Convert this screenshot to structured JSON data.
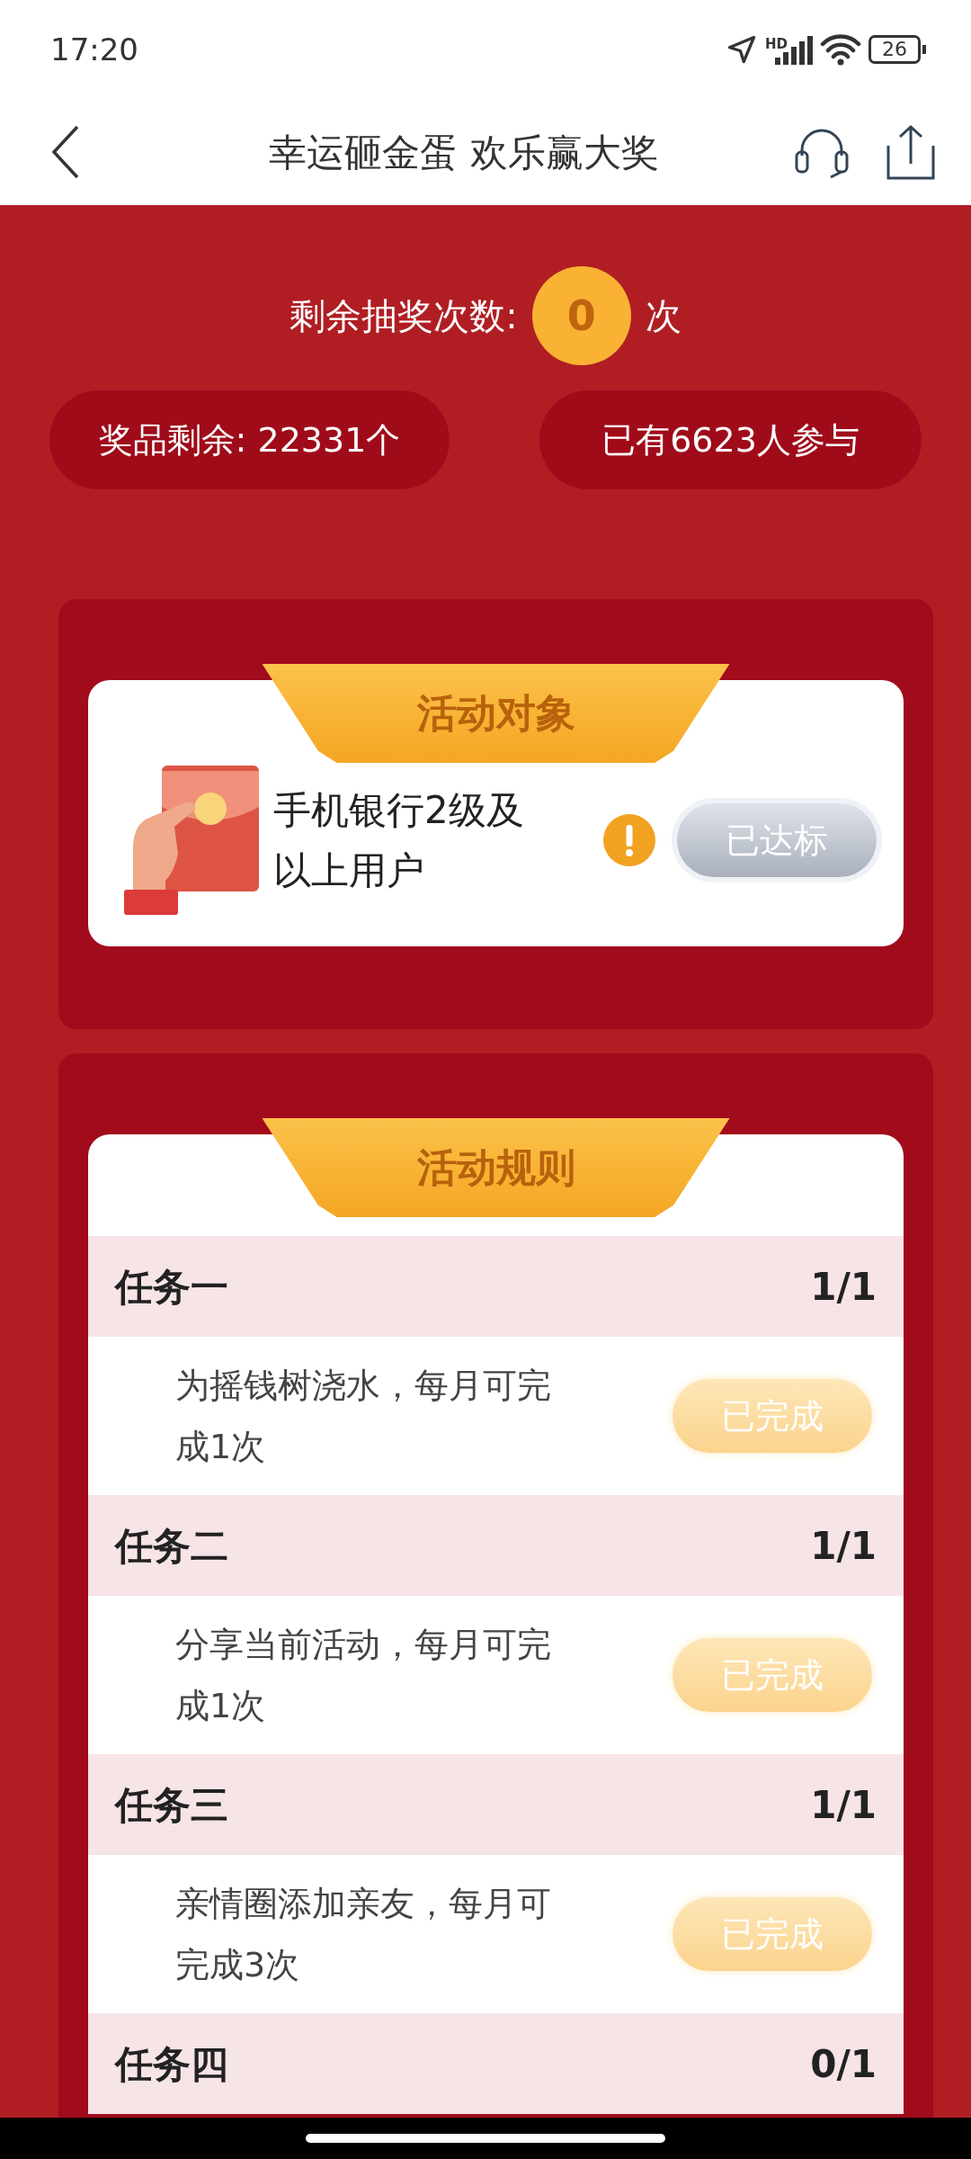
{
  "status_bar": {
    "time": "17:20",
    "network": "HD",
    "battery": "26"
  },
  "nav": {
    "title": "幸运砸金蛋 欢乐赢大奖"
  },
  "draws": {
    "label": "剩余抽奖次数:",
    "count": "0",
    "unit": "次"
  },
  "stats": [
    "奖品剩余: 22331个",
    "已有6623人参与"
  ],
  "target": {
    "title": "活动对象",
    "text": "手机银行2级及以上用户",
    "button": "已达标",
    "achieved": true
  },
  "rules": {
    "title": "活动规则",
    "tasks": [
      {
        "name": "任务一",
        "progress": "1/1",
        "description": "为摇钱树浇水，每月可完成1次",
        "button": "已完成",
        "done": true
      },
      {
        "name": "任务二",
        "progress": "1/1",
        "description": "分享当前活动，每月可完成1次",
        "button": "已完成",
        "done": true
      },
      {
        "name": "任务三",
        "progress": "1/1",
        "description": "亲情圈添加亲友，每月可完成3次",
        "button": "已完成",
        "done": true
      },
      {
        "name": "任务四",
        "progress": "0/1"
      }
    ]
  }
}
